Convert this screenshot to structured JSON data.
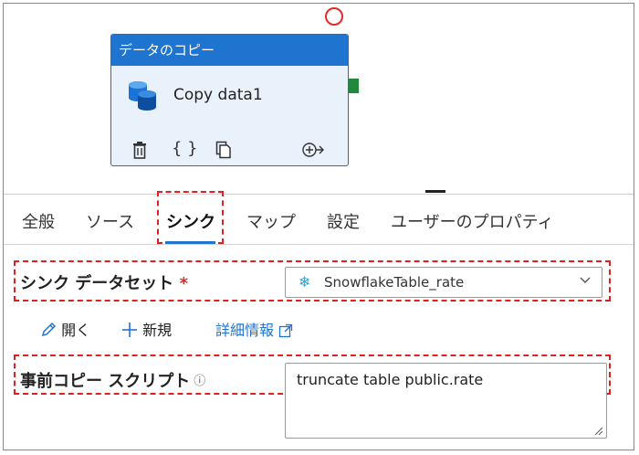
{
  "activity": {
    "header": "データのコピー",
    "name": "Copy data1",
    "tools": [
      "delete-icon",
      "braces-icon",
      "copy-icon",
      "add-output-icon"
    ]
  },
  "tabs": [
    {
      "label": "全般",
      "active": false
    },
    {
      "label": "ソース",
      "active": false
    },
    {
      "label": "シンク",
      "active": true
    },
    {
      "label": "マップ",
      "active": false
    },
    {
      "label": "設定",
      "active": false
    },
    {
      "label": "ユーザーのプロパティ",
      "active": false
    }
  ],
  "sink": {
    "dataset_label": "シンク データセット",
    "required_mark": "*",
    "dataset_value": "SnowflakeTable_rate",
    "open_label": "開く",
    "new_label": "新規",
    "details_label": "詳細情報",
    "pre_copy_label": "事前コピー スクリプト",
    "pre_copy_value": "truncate table public.rate"
  },
  "colors": {
    "accent": "#1f74d0",
    "highlight_border": "#e02020",
    "output_port": "#1f8a3c"
  }
}
